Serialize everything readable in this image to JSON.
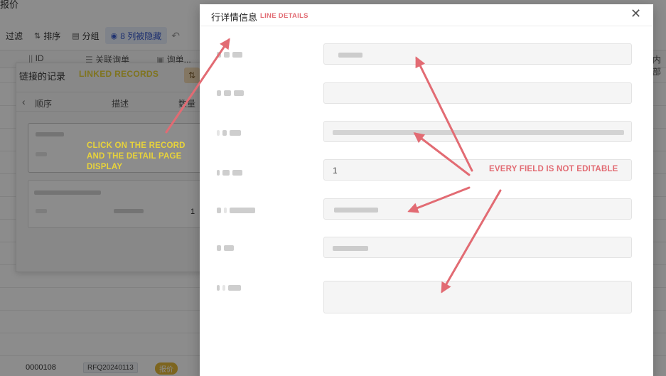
{
  "app": {
    "title": "报价",
    "toolbar": {
      "filter": "过滤",
      "sort": "排序",
      "group": "分组",
      "hidden_columns": "8 列被隐藏",
      "undo_icon": "undo-icon"
    },
    "columns": [
      "ID",
      "关联询单",
      "询单...",
      "内部"
    ],
    "bottom_row": {
      "id": "0000108",
      "rfq": "RFQ20240113",
      "tag": "报价"
    }
  },
  "linked_records": {
    "title": "链接的记录",
    "title_en": "LINKED RECORDS",
    "columns": [
      "顺序",
      "描述",
      "数量"
    ],
    "records": [
      {
        "quantity": ""
      },
      {
        "quantity": "1"
      }
    ]
  },
  "annotations": {
    "click_hint": "CLICK ON THE RECORD AND THE DETAIL PAGE DISPLAY",
    "not_editable": "EVERY FIELD IS NOT EDITABLE",
    "color_yellow": "#e8d33a",
    "color_red": "#e26b73"
  },
  "modal": {
    "title": "行详情信息",
    "title_en": "LINE DETAILS",
    "close_icon": "close-icon",
    "fields": [
      {
        "value": ""
      },
      {
        "value": ""
      },
      {
        "value": ""
      },
      {
        "value": "1"
      },
      {
        "value": ""
      },
      {
        "value": ""
      },
      {
        "value": ""
      }
    ]
  }
}
